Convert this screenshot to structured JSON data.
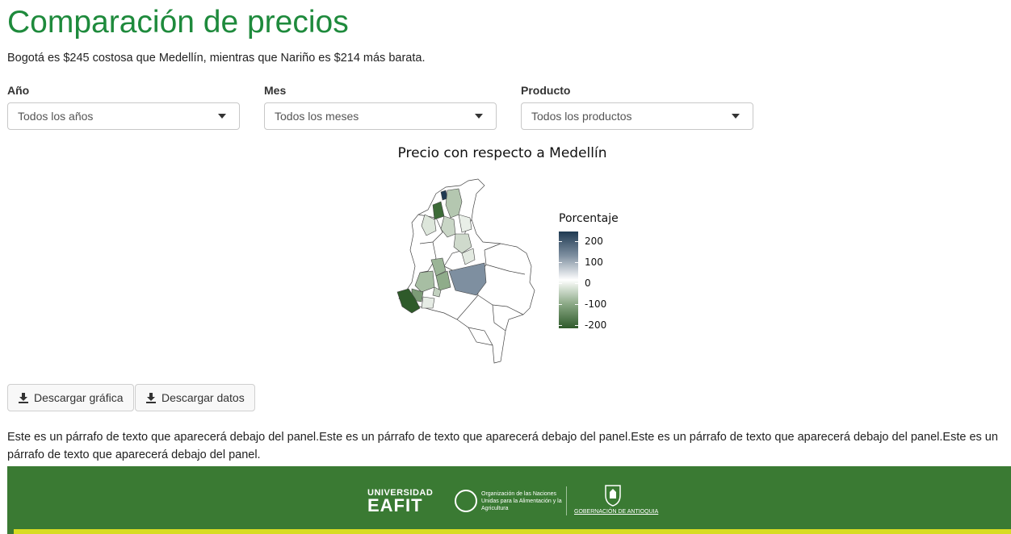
{
  "header": {
    "title": "Comparación de precios",
    "subtitle": "Bogotá es $245 costosa que Medellín, mientras que Nariño es $214 más barata."
  },
  "filters": [
    {
      "label": "Año",
      "value": "Todos los años"
    },
    {
      "label": "Mes",
      "value": "Todos los meses"
    },
    {
      "label": "Producto",
      "value": "Todos los productos"
    }
  ],
  "map": {
    "title": "Precio con respecto a Medellín",
    "legend": {
      "title": "Porcentaje",
      "ticks": [
        "200",
        "100",
        "0",
        "-100",
        "-200"
      ],
      "colors": {
        "high": "#1f3a52",
        "mid": "#ffffff",
        "low": "#2e5a2a"
      }
    }
  },
  "buttons": {
    "download_chart": "Descargar gráfica",
    "download_data": "Descargar datos"
  },
  "paragraph": "Este es un párrafo de texto que aparecerá debajo del panel.Este es un párrafo de texto que aparecerá debajo del panel.Este es un párrafo de texto que aparecerá debajo del panel.Este es un párrafo de texto que aparecerá debajo del panel.",
  "footer": {
    "eafit_line1": "UNIVERSIDAD",
    "eafit_line2": "EAFIT",
    "fao_text": "Organización de las Naciones Unidas para la Alimentación y la Agricultura",
    "gob_text": "GOBERNACIÓN DE ANTIOQUIA",
    "colors": {
      "background": "#3a7a33",
      "stripe": "#d8dc22"
    }
  }
}
